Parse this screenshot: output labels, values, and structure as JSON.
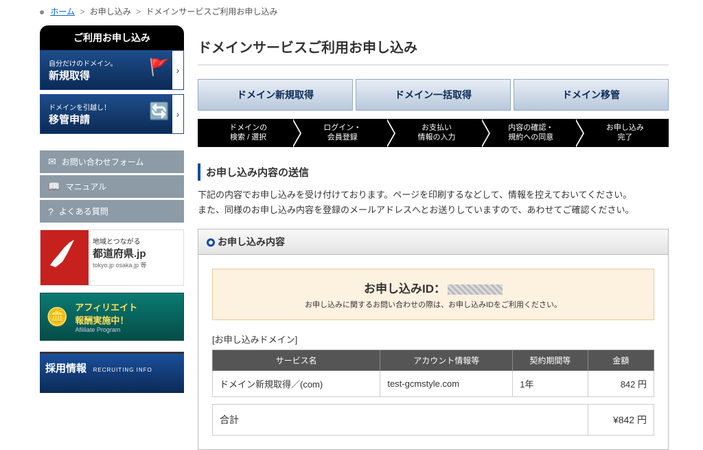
{
  "breadcrumb": {
    "home": "ホーム",
    "step1": "お申し込み",
    "step2": "ドメインサービスご利用お申し込み"
  },
  "sidebar": {
    "title": "ご利用お申し込み",
    "card1": {
      "sub": "自分だけのドメイン。",
      "main": "新規取得"
    },
    "card2": {
      "sub": "ドメインを引越し！",
      "main": "移管申請"
    },
    "links": [
      {
        "icon": "mail",
        "label": "お問い合わせフォーム"
      },
      {
        "icon": "book",
        "label": "マニュアル"
      },
      {
        "icon": "help",
        "label": "よくある質問"
      }
    ],
    "jp": {
      "t1": "地域とつながる",
      "t2": "都道府県.jp",
      "t3": "tokyo.jp osaka.jp 等"
    },
    "aff": {
      "t1": "アフィリエイト\n報酬実施中！",
      "t2": "Afiiliate Program"
    },
    "rec": {
      "t1": "採用情報",
      "t2": "RECRUITING INFO"
    }
  },
  "page": {
    "title": "ドメインサービスご利用お申し込み",
    "tabs": [
      "ドメイン新規取得",
      "ドメイン一括取得",
      "ドメイン移管"
    ],
    "steps": [
      "ドメインの\n検索 / 選択",
      "ログイン・\n会員登録",
      "お支払い\n情報の入力",
      "内容の確認・\n規約への同意",
      "お申し込み\n完了"
    ],
    "h2": "お申し込み内容の送信",
    "desc": "下記の内容でお申し込みを受け付けております。ページを印刷するなどして、情報を控えておいてください。\nまた、同様のお申し込み内容を登録のメールアドレスへとお送りしていますので、あわせてご確認ください。",
    "panel_title": "お申し込み内容",
    "idbox": {
      "label": "お申し込みID：",
      "note": "お申し込みに関するお問い合わせの際は、お申し込みIDをご利用ください。"
    },
    "section_label": "[お申し込みドメイン]",
    "table": {
      "headers": [
        "サービス名",
        "アカウント情報等",
        "契約期間等",
        "金額"
      ],
      "row": {
        "service": "ドメイン新規取得／(com)",
        "account": "test-gcmstyle.com",
        "term": "1年",
        "price": "842 円"
      }
    },
    "total": {
      "label": "合計",
      "value": "¥842 円"
    }
  }
}
